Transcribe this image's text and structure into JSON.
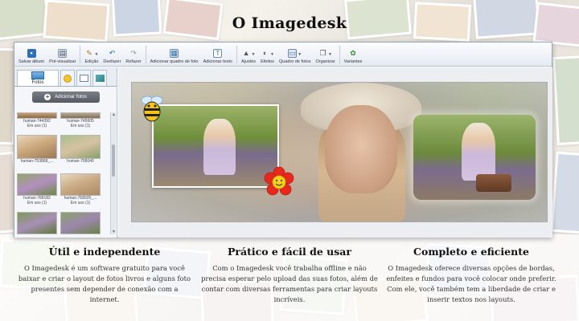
{
  "page": {
    "title": "O Imagedesk"
  },
  "toolbar": {
    "buttons": [
      {
        "label": "Salvar álbum",
        "icon": "save-icon"
      },
      {
        "label": "Pré-visualizar",
        "icon": "preview-icon"
      },
      {
        "label": "Edição",
        "icon": "pencil-icon"
      },
      {
        "label": "Desfazer",
        "icon": "undo-icon"
      },
      {
        "label": "Refazer",
        "icon": "redo-icon"
      },
      {
        "label": "Adicionar quadro de foto",
        "icon": "add-frame-icon"
      },
      {
        "label": "Adicionar texto",
        "icon": "add-text-icon"
      },
      {
        "label": "Ajustes",
        "icon": "adjust-icon"
      },
      {
        "label": "Efeitos",
        "icon": "effects-icon"
      },
      {
        "label": "Quadro de fotos",
        "icon": "photo-frame-icon"
      },
      {
        "label": "Organizar",
        "icon": "arrange-icon"
      },
      {
        "label": "Variantes",
        "icon": "variants-icon"
      }
    ]
  },
  "sidebar": {
    "tabs": [
      {
        "label": "Fotos"
      }
    ],
    "add_photos_label": "Adicionar fotos",
    "thumbnails": [
      {
        "name": "human-744392",
        "status": "Em uso (1)"
      },
      {
        "name": "human-745605",
        "status": "Em uso (1)"
      },
      {
        "name": "human-753868_...",
        "status": ""
      },
      {
        "name": "human-768040",
        "status": ""
      },
      {
        "name": "human-768182",
        "status": "Em uso (1)"
      },
      {
        "name": "human-768025_...",
        "status": "Em uso (1)"
      }
    ]
  },
  "features": [
    {
      "title": "Útil e independente",
      "text": "O Imagedesk é um software gratuito para você baixar e criar o layout de fotos livros e alguns foto presentes sem depender de conexão com a internet."
    },
    {
      "title": "Prático e fácil de usar",
      "text": "Com o Imagedesk você trabalha offline e não precisa esperar pelo upload das suas fotos, além de contar com diversas ferramentas para criar layouts incríveis."
    },
    {
      "title": "Completo e eficiente",
      "text": "O Imagedesk oferece diversas opções de bordas, enfeites e fundos para você colocar onde preferir. Com ele, você também tem a liberdade de criar e inserir textos nos layouts."
    }
  ],
  "colors": {
    "accent": "#3e86c6",
    "toolbar_bg": "#e6ebf2",
    "button_dark": "#555a62"
  }
}
